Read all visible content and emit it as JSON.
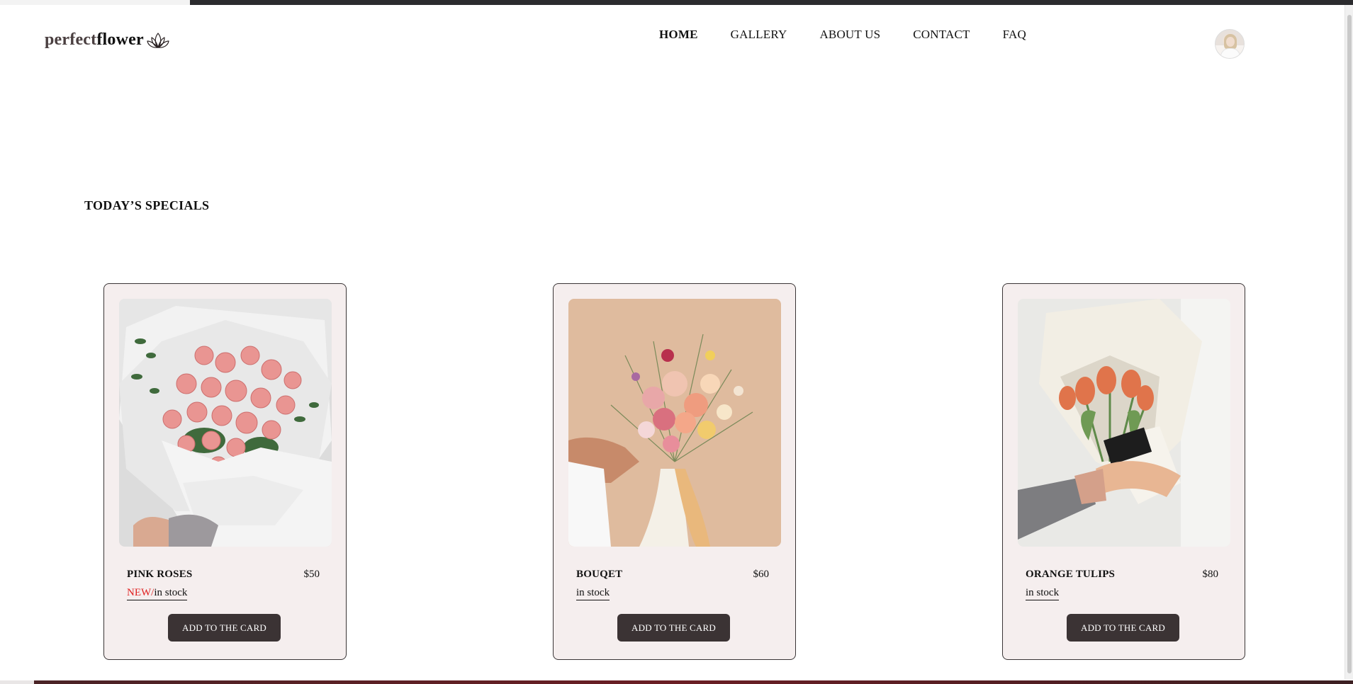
{
  "logo": {
    "part1": "perfect",
    "part2": "flower",
    "icon": "lotus-icon"
  },
  "nav": {
    "items": [
      {
        "label": "HOME",
        "active": true
      },
      {
        "label": "GALLERY",
        "active": false
      },
      {
        "label": "ABOUT US",
        "active": false
      },
      {
        "label": "CONTACT",
        "active": false
      },
      {
        "label": "FAQ",
        "active": false
      }
    ]
  },
  "user": {
    "avatar_icon": "user-avatar"
  },
  "specials": {
    "title": "TODAY’S SPECIALS",
    "products": [
      {
        "name": "PINK ROSES",
        "price": "$50",
        "badge": "NEW/",
        "stock": "in stock",
        "button": "ADD TO THE CARD",
        "image": "pink-roses-bouquet"
      },
      {
        "name": "BOUQET",
        "price": "$60",
        "badge": "",
        "stock": "in stock",
        "button": "ADD TO THE CARD",
        "image": "mixed-bouquet"
      },
      {
        "name": "ORANGE TULIPS",
        "price": "$80",
        "badge": "",
        "stock": "in stock",
        "button": "ADD TO THE CARD",
        "image": "orange-tulips-bouquet"
      }
    ]
  },
  "colors": {
    "card_bg": "#f5eeee",
    "button_bg": "#3b3334",
    "badge_red": "#e02020",
    "text": "#111111"
  }
}
